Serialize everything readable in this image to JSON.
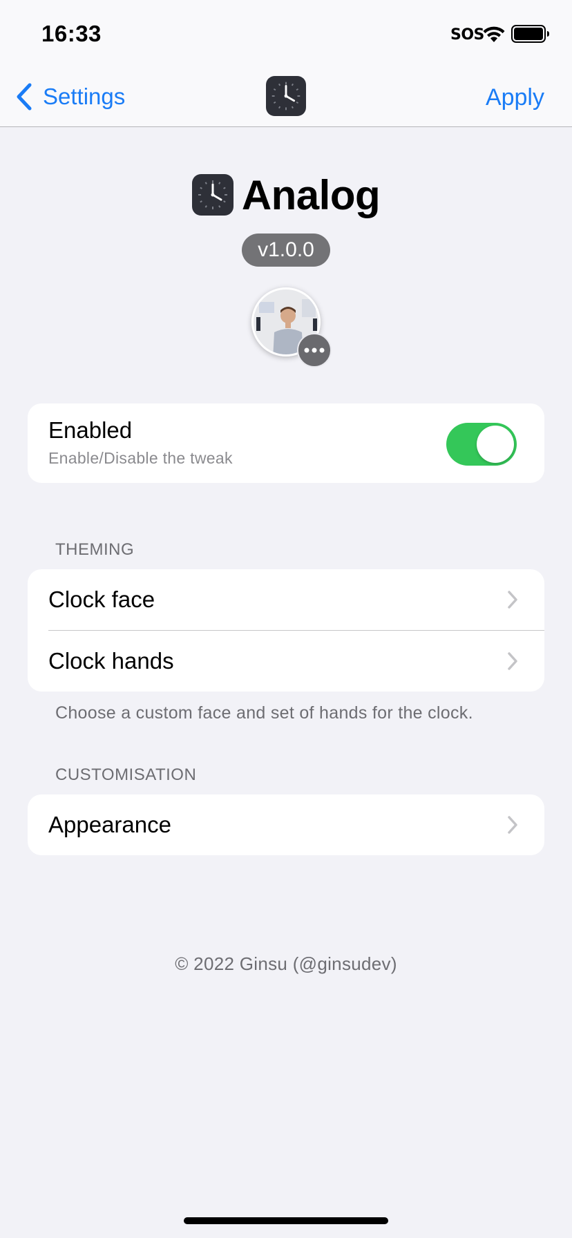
{
  "status_bar": {
    "time": "16:33",
    "carrier": "SOS"
  },
  "nav": {
    "back_label": "Settings",
    "action_label": "Apply"
  },
  "header": {
    "title": "Analog",
    "version": "v1.0.0"
  },
  "enabled_cell": {
    "title": "Enabled",
    "subtitle": "Enable/Disable the tweak",
    "toggle_on": true
  },
  "theming": {
    "header": "THEMING",
    "rows": [
      {
        "label": "Clock face"
      },
      {
        "label": "Clock hands"
      }
    ],
    "footer": "Choose a custom face and set of hands for the clock."
  },
  "customisation": {
    "header": "CUSTOMISATION",
    "rows": [
      {
        "label": "Appearance"
      }
    ]
  },
  "copyright": "© 2022 Ginsu (@ginsudev)",
  "colors": {
    "accent": "#1a7cf6",
    "toggle_on": "#34c759",
    "background": "#f2f2f7"
  },
  "icons": [
    "wifi-icon",
    "battery-icon",
    "chevron-left-icon",
    "clock-app-icon",
    "more-icon",
    "chevron-right-icon"
  ]
}
